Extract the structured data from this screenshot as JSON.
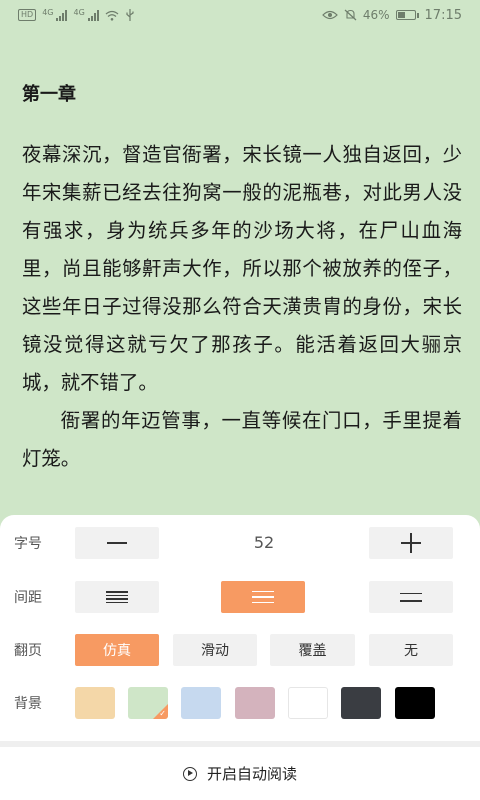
{
  "status_bar": {
    "left_badge": "HD",
    "left_net": "4G",
    "left_net2": "4G",
    "battery_text": "46%",
    "battery_level": 0.46,
    "time": "17:15"
  },
  "reader": {
    "chapter_title": "第一章",
    "paragraphs": [
      "夜幕深沉，督造官衙署，宋长镜一人独自返回，少年宋集薪已经去往狗窝一般的泥瓶巷，对此男人没有强求，身为统兵多年的沙场大将，在尸山血海里，尚且能够鼾声大作，所以那个被放养的侄子，这些年日子过得没那么符合天潢贵胄的身份，宋长镜没觉得这就亏欠了那孩子。能活着返回大骊京城，就不错了。",
      "衙署的年迈管事，一直等候在门口，手里提着灯笼。"
    ]
  },
  "settings": {
    "font_size": {
      "label": "字号",
      "value": "52"
    },
    "spacing": {
      "label": "间距",
      "selected_index": 1
    },
    "page_turn": {
      "label": "翻页",
      "options": [
        "仿真",
        "滑动",
        "覆盖",
        "无"
      ],
      "selected_index": 0
    },
    "background": {
      "label": "背景",
      "colors": [
        "#f4d7a8",
        "#cfe6c8",
        "#c6d9ef",
        "#d4b3bd",
        "#ffffff",
        "#3a3d42",
        "#000000"
      ],
      "selected_index": 1
    }
  },
  "auto_read": {
    "label": "开启自动阅读"
  },
  "colors": {
    "accent": "#f79a62",
    "reader_bg": "#cfe6c8"
  }
}
